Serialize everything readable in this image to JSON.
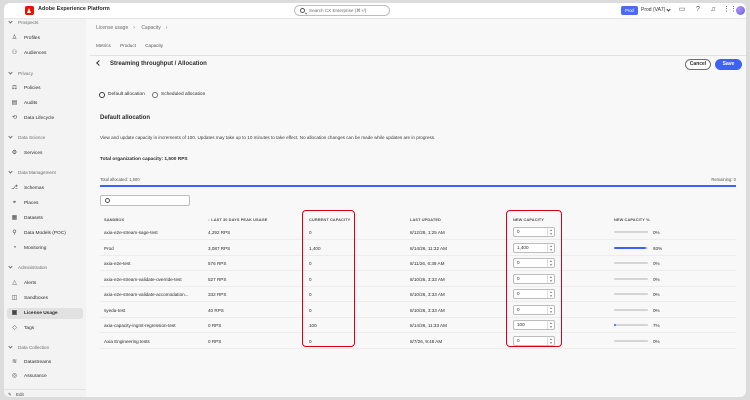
{
  "topbar": {
    "app_title": "Adobe Experience Platform",
    "search_placeholder": "Search CX Enterprise (⌘+/)",
    "org_badge": "Prod",
    "org_name": "Prod (VA7)"
  },
  "sidebar": {
    "sections": [
      {
        "title": "Prospects",
        "items": [
          "Profiles",
          "Audiences"
        ]
      },
      {
        "title": "Privacy",
        "items": [
          "Policies",
          "Audits",
          "Data Lifecycle"
        ]
      },
      {
        "title": "Data Science",
        "items": [
          "Services"
        ]
      },
      {
        "title": "Data Management",
        "items": [
          "Schemas",
          "Places",
          "Datasets",
          "Data Models (POC)",
          "Monitoring"
        ]
      },
      {
        "title": "Administration",
        "items": [
          "Alerts",
          "Sandboxes",
          "License Usage",
          "Tags"
        ]
      },
      {
        "title": "Data Collection",
        "items": [
          "Datastreams",
          "Assurance"
        ]
      }
    ],
    "active_item": "License Usage",
    "edit_label": "Edit"
  },
  "breadcrumb": [
    "License usage",
    "Capacity"
  ],
  "subtabs": [
    "Metrics",
    "Product",
    "Capacity"
  ],
  "page": {
    "title": "Streaming throughput / Allocation",
    "cancel_label": "Cancel",
    "save_label": "Save",
    "radio_default": "Default allocation",
    "radio_scheduled": "Scheduled allocation",
    "section_title": "Default allocation",
    "description": "View and update capacity in increments of 100. Updates may take up to 10 minutes to take effect. No allocation changes can be made while updates are in progress.",
    "total_capacity": "Total organization capacity: 1,500 RPS",
    "total_allocated": "Total allocated: 1,500",
    "remaining": "Remaining: 0",
    "allocated_fraction": 1.0
  },
  "table": {
    "columns": [
      "SANDBOX",
      "LAST 30 DAYS PEAK USAGE",
      "CURRENT CAPACITY",
      "LAST UPDATED",
      "NEW CAPACITY",
      "NEW CAPACITY %"
    ],
    "rows": [
      {
        "sandbox": "axia-e2e-stream-sage-test",
        "peak": "4,292 RPS",
        "current": "0",
        "updated": "8/12/26, 1:25 AM",
        "new": "0",
        "pct": "0%",
        "pct_value": 0
      },
      {
        "sandbox": "Prod",
        "peak": "3,087 RPS",
        "current": "1,400",
        "updated": "8/14/26, 11:32 AM",
        "new": "1,400",
        "pct": "93%",
        "pct_value": 93
      },
      {
        "sandbox": "axia-e2e-test",
        "peak": "576 RPS",
        "current": "0",
        "updated": "8/11/26, 6:39 AM",
        "new": "0",
        "pct": "0%",
        "pct_value": 0
      },
      {
        "sandbox": "axia-e2e-stream-validate-override-test",
        "peak": "527 RPS",
        "current": "0",
        "updated": "8/10/26, 3:33 AM",
        "new": "0",
        "pct": "0%",
        "pct_value": 0
      },
      {
        "sandbox": "axia-e2e-stream-validate-accomodation...",
        "peak": "332 RPS",
        "current": "0",
        "updated": "8/10/26, 3:33 AM",
        "new": "0",
        "pct": "0%",
        "pct_value": 0
      },
      {
        "sandbox": "syeda-test",
        "peak": "40 RPS",
        "current": "0",
        "updated": "8/10/26, 3:33 AM",
        "new": "0",
        "pct": "0%",
        "pct_value": 0
      },
      {
        "sandbox": "axia-capacity-ingmt-regression-test",
        "peak": "0 RPS",
        "current": "100",
        "updated": "8/14/26, 11:33 AM",
        "new": "100",
        "pct": "7%",
        "pct_value": 7
      },
      {
        "sandbox": "Axia Engineering tests",
        "peak": "0 RPS",
        "current": "0",
        "updated": "8/7/26, 9:48 AM",
        "new": "0",
        "pct": "0%",
        "pct_value": 0
      }
    ]
  },
  "colors": {
    "accent": "#3b63fb",
    "highlight": "#d6001c",
    "brand": "#eb1000"
  }
}
